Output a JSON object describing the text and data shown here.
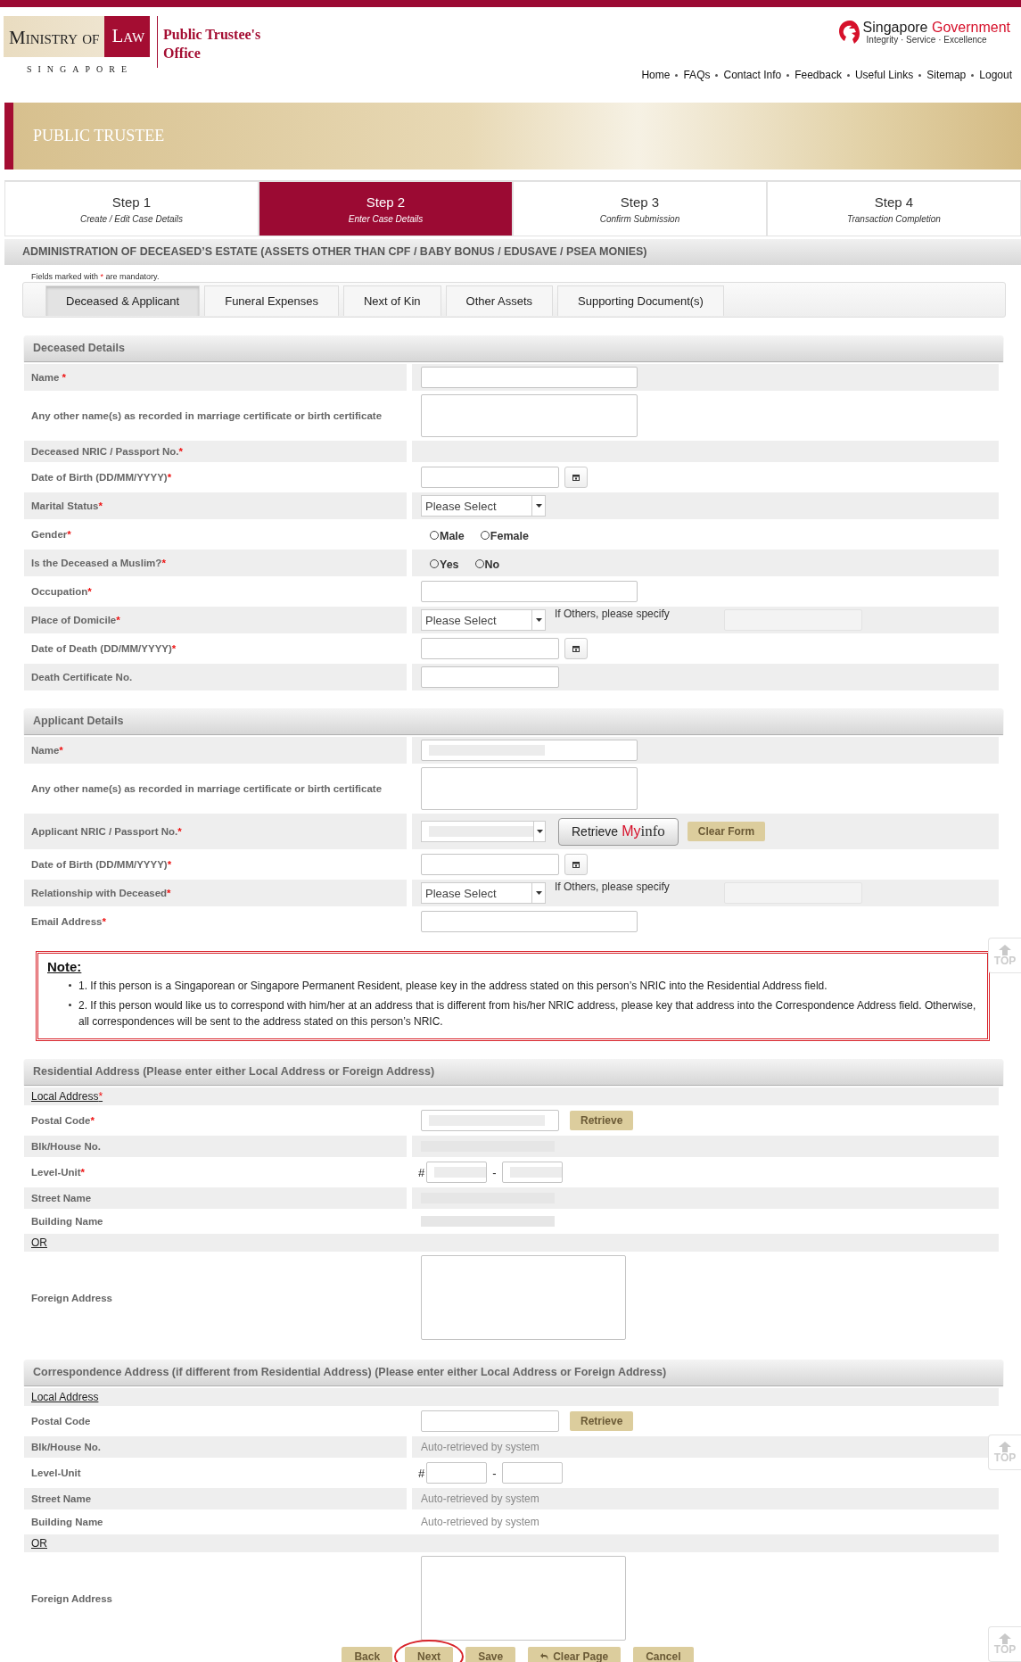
{
  "header": {
    "logo": {
      "ministry": "Ministry of",
      "law": "Law",
      "country": "SINGAPORE",
      "office": "Public Trustee's Office"
    },
    "government": {
      "name": "Singapore",
      "accent": "Government",
      "motto": "Integrity · Service · Excellence"
    },
    "nav": [
      "Home",
      "FAQs",
      "Contact Info",
      "Feedback",
      "Useful Links",
      "Sitemap",
      "Logout"
    ]
  },
  "banner": {
    "title": "PUBLIC TRUSTEE"
  },
  "steps": [
    {
      "title": "Step 1",
      "subtitle": "Create / Edit Case Details",
      "selected": false
    },
    {
      "title": "Step 2",
      "subtitle": "Enter Case Details",
      "selected": true
    },
    {
      "title": "Step 3",
      "subtitle": "Confirm Submission",
      "selected": false
    },
    {
      "title": "Step 4",
      "subtitle": "Transaction Completion",
      "selected": false
    }
  ],
  "page_title": "ADMINISTRATION OF DECEASED’S ESTATE (ASSETS OTHER THAN CPF / BABY BONUS / EDUSAVE / PSEA MONIES)",
  "mandatory_note": {
    "before": "Fields marked with ",
    "mark": "*",
    "after": " are mandatory."
  },
  "tabs": [
    {
      "label": "Deceased & Applicant",
      "selected": true
    },
    {
      "label": "Funeral Expenses",
      "selected": false
    },
    {
      "label": "Next of Kin",
      "selected": false
    },
    {
      "label": "Other Assets",
      "selected": false
    },
    {
      "label": "Supporting Document(s)",
      "selected": false
    }
  ],
  "sections": [
    {
      "kind": "form",
      "title": "Deceased Details",
      "rows": [
        {
          "kind": "text",
          "label": "Name ",
          "mark": "*"
        },
        {
          "kind": "textarea",
          "label": "Any other name(s) as recorded in marriage certificate or birth certificate"
        },
        {
          "kind": "static",
          "label": "Deceased NRIC / Passport No.",
          "mark": "*"
        },
        {
          "kind": "date",
          "label": "Date of Birth  (DD/MM/YYYY)",
          "mark": "*"
        },
        {
          "kind": "select",
          "label": "Marital Status",
          "mark": "*",
          "value": "Please Select"
        },
        {
          "kind": "radio",
          "label": "Gender",
          "mark": "*",
          "options": [
            {
              "label": "Male",
              "selected": false
            },
            {
              "label": "Female",
              "selected": false
            }
          ]
        },
        {
          "kind": "radio",
          "label": "Is the Deceased a Muslim?",
          "mark": "*",
          "options": [
            {
              "label": "Yes",
              "selected": false
            },
            {
              "label": "No",
              "selected": false
            }
          ]
        },
        {
          "kind": "text",
          "label": "Occupation",
          "mark": "*"
        },
        {
          "kind": "select-other",
          "label": "Place of Domicile",
          "mark": "*",
          "value": "Please Select",
          "other": "If Others, please specify"
        },
        {
          "kind": "date",
          "label": "Date of Death  (DD/MM/YYYY)",
          "mark": "*"
        },
        {
          "kind": "short-text",
          "label": "Death Certificate No."
        }
      ]
    },
    {
      "kind": "form",
      "title": "Applicant Details",
      "rows": [
        {
          "kind": "text",
          "label": "Name",
          "mark": "*",
          "redacted": true
        },
        {
          "kind": "textarea",
          "label": "Any other name(s) as recorded in marriage certificate or birth certificate"
        },
        {
          "kind": "myinfo",
          "label": "Applicant NRIC / Passport No.",
          "mark": "*",
          "redacted": true,
          "myinfo_button": [
            "Retrieve ",
            "My",
            "info"
          ],
          "clear_button": "Clear Form"
        },
        {
          "kind": "date",
          "label": "Date of Birth  (DD/MM/YYYY)",
          "mark": "*"
        },
        {
          "kind": "select-other",
          "label": "Relationship with Deceased",
          "mark": "*",
          "value": "Please Select",
          "other": "If Others, please specify"
        },
        {
          "kind": "text",
          "label": "Email Address",
          "mark": "*"
        }
      ]
    },
    {
      "kind": "note",
      "title": "Note:",
      "items": [
        "1. If this person is a Singaporean or Singapore Permanent Resident, please key in the address stated on this person’s NRIC into the Residential Address field.",
        "2. If this person would like us to correspond with him/her at an address that is different from his/her NRIC address, please key that address into the Correspondence Address field. Otherwise, all correspondences will be sent to the address stated on this person’s NRIC."
      ]
    },
    {
      "kind": "form",
      "title": "Residential Address (Please enter either Local Address or Foreign Address)",
      "rows": [
        {
          "kind": "subheading",
          "label": "Local Address",
          "mark": "*"
        },
        {
          "kind": "postal",
          "label": "Postal Code",
          "mark": "*",
          "redacted": true,
          "button": "Retrieve"
        },
        {
          "kind": "static",
          "label": "Blk/House No.",
          "redacted": true
        },
        {
          "kind": "level-unit",
          "label": "Level-Unit",
          "mark": "*",
          "redacted": true,
          "prefix": "#",
          "separator": "-"
        },
        {
          "kind": "static",
          "label": "Street Name",
          "redacted": true
        },
        {
          "kind": "static",
          "label": "Building Name",
          "redacted": true
        },
        {
          "kind": "subheading",
          "label": "OR"
        },
        {
          "kind": "foreign",
          "label": "Foreign Address"
        }
      ]
    },
    {
      "kind": "form",
      "title": "Correspondence Address (if different from Residential Address) (Please enter either Local Address or Foreign Address)",
      "rows": [
        {
          "kind": "subheading",
          "label": "Local Address"
        },
        {
          "kind": "postal",
          "label": "Postal Code",
          "button": "Retrieve"
        },
        {
          "kind": "static",
          "label": "Blk/House No.",
          "value": "Auto-retrieved by system"
        },
        {
          "kind": "level-unit",
          "label": "Level-Unit",
          "prefix": "#",
          "separator": "-"
        },
        {
          "kind": "static",
          "label": "Street Name",
          "value": "Auto-retrieved by system"
        },
        {
          "kind": "static",
          "label": "Building Name",
          "value": "Auto-retrieved by system"
        },
        {
          "kind": "subheading",
          "label": "OR"
        },
        {
          "kind": "foreign",
          "label": "Foreign Address"
        }
      ]
    }
  ],
  "buttons": [
    {
      "label": "Back",
      "highlighted": false
    },
    {
      "label": "Next",
      "highlighted": true
    },
    {
      "label": "Save",
      "highlighted": false
    },
    {
      "label": "Clear Page",
      "kind": "undo",
      "highlighted": false
    },
    {
      "label": "Cancel",
      "highlighted": false
    }
  ],
  "top_links": [
    "TOP",
    "TOP",
    "TOP"
  ]
}
